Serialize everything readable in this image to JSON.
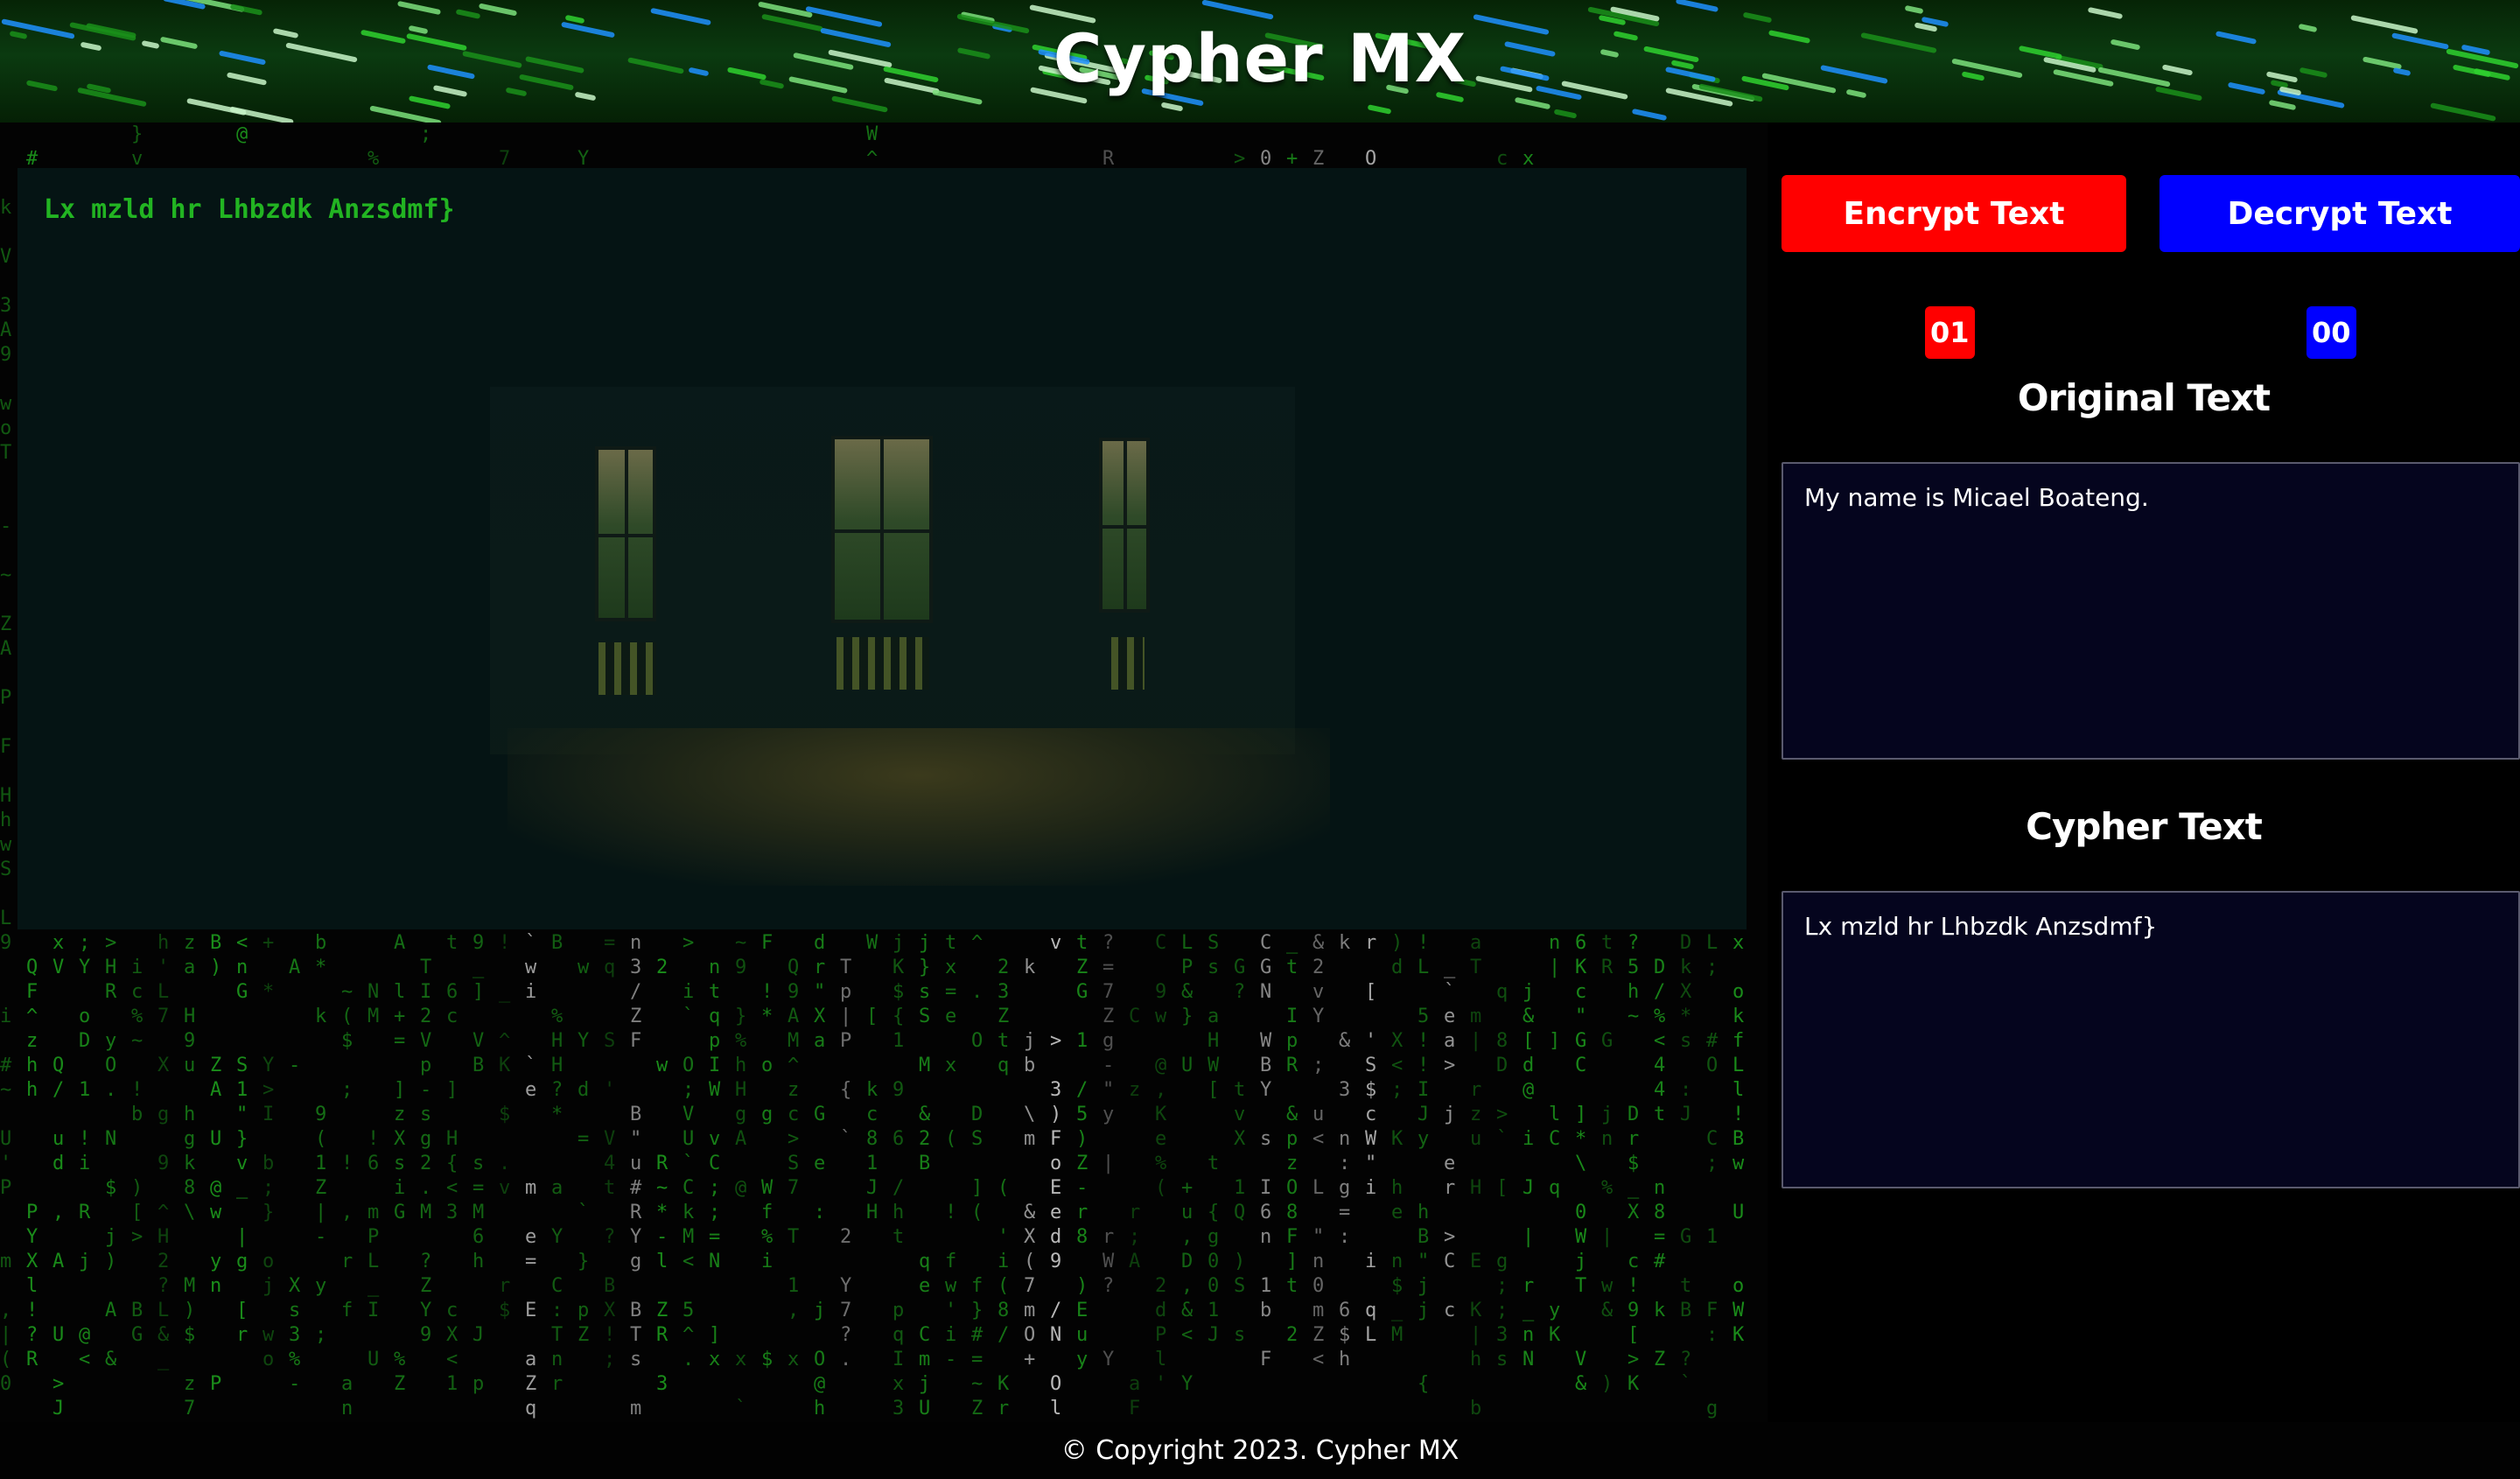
{
  "header": {
    "title": "Cypher MX"
  },
  "display": {
    "text": "Lx mzld hr Lhbzdk Anzsdmf}"
  },
  "controls": {
    "encrypt_label": "Encrypt Text",
    "decrypt_label": "Decrypt Text",
    "encrypt_count": "01",
    "decrypt_count": "00",
    "encrypt_color": "#ff0000",
    "decrypt_color": "#0000ff"
  },
  "original": {
    "title": "Original Text",
    "value": "My name is Micael Boateng."
  },
  "cypher": {
    "title": "Cypher Text",
    "value": "Lx mzld hr Lhbzdk Anzsdmf}"
  },
  "footer": {
    "text": "© Copyright 2023. Cypher MX"
  },
  "theme": {
    "matrix_green": "#1fa81f",
    "text_green": "#22b422",
    "panel_bg": "#05051e"
  }
}
